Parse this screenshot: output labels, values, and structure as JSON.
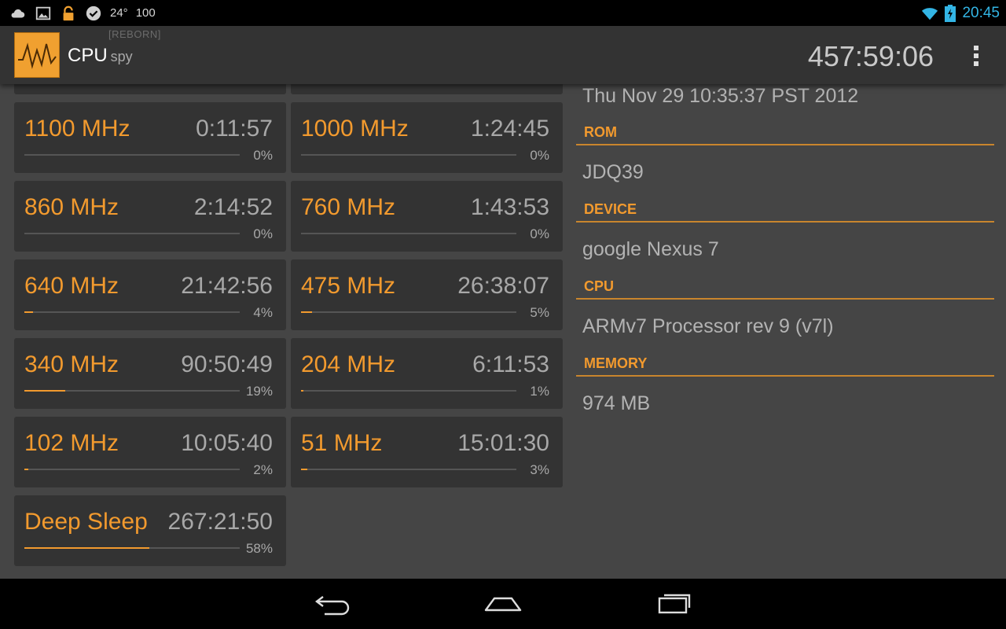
{
  "status_bar": {
    "temperature": "24°",
    "battery_level": "100",
    "time": "20:45",
    "left_icons": [
      "cloud-icon",
      "image-icon",
      "lock-icon",
      "check-icon"
    ],
    "right_icons": [
      "wifi-icon",
      "battery-charging-icon"
    ]
  },
  "action_bar": {
    "title": "CPU",
    "subtitle": "spy",
    "tag": "[REBORN]",
    "uptime": "457:59:06",
    "menu_icon": "overflow-menu-icon"
  },
  "colors": {
    "accent": "#f29a2e",
    "background": "#454545",
    "card": "#333333",
    "status_time": "#33b5e5"
  },
  "states": [
    {
      "freq": "1100 MHz",
      "time": "0:11:57",
      "percent": "0%",
      "fraction": 0.0
    },
    {
      "freq": "1000 MHz",
      "time": "1:24:45",
      "percent": "0%",
      "fraction": 0.0
    },
    {
      "freq": "860 MHz",
      "time": "2:14:52",
      "percent": "0%",
      "fraction": 0.0
    },
    {
      "freq": "760 MHz",
      "time": "1:43:53",
      "percent": "0%",
      "fraction": 0.0
    },
    {
      "freq": "640 MHz",
      "time": "21:42:56",
      "percent": "4%",
      "fraction": 0.04
    },
    {
      "freq": "475 MHz",
      "time": "26:38:07",
      "percent": "5%",
      "fraction": 0.05
    },
    {
      "freq": "340 MHz",
      "time": "90:50:49",
      "percent": "19%",
      "fraction": 0.19
    },
    {
      "freq": "204 MHz",
      "time": "6:11:53",
      "percent": "1%",
      "fraction": 0.01
    },
    {
      "freq": "102 MHz",
      "time": "10:05:40",
      "percent": "2%",
      "fraction": 0.02
    },
    {
      "freq": "51 MHz",
      "time": "15:01:30",
      "percent": "3%",
      "fraction": 0.03
    },
    {
      "freq": "Deep Sleep",
      "time": "267:21:50",
      "percent": "58%",
      "fraction": 0.58
    }
  ],
  "info": {
    "date": "Thu Nov 29 10:35:37 PST 2012",
    "rom_header": "ROM",
    "rom": "JDQ39",
    "device_header": "DEVICE",
    "device": "google Nexus 7",
    "cpu_header": "CPU",
    "cpu": "ARMv7 Processor rev 9 (v7l)",
    "memory_header": "MEMORY",
    "memory": "974 MB"
  },
  "nav_bar": {
    "icons": [
      "back-icon",
      "home-icon",
      "recent-apps-icon"
    ]
  }
}
